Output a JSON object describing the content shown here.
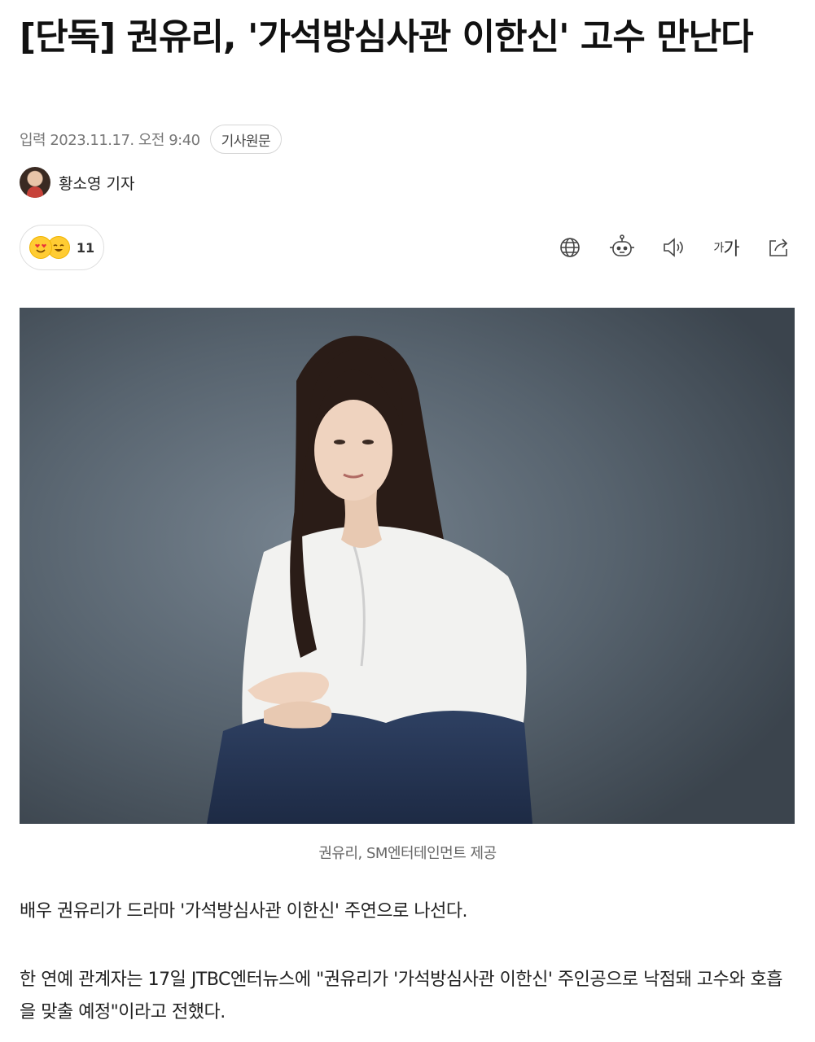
{
  "article": {
    "title": "[단독] 권유리, '가석방심사관 이한신' 고수 만난다",
    "published_label": "입력",
    "published_at": "2023.11.17. 오전 9:40",
    "original_article_button": "기사원문",
    "reporter": "황소영 기자",
    "reaction_count": "11",
    "toolbar": {
      "icons": [
        "globe-icon",
        "robot-icon",
        "speaker-icon",
        "font-size-icon",
        "share-icon"
      ],
      "font_size_small": "가",
      "font_size_large": "가"
    },
    "photo_caption": "권유리, SM엔터테인먼트 제공",
    "paragraphs": [
      "배우 권유리가 드라마 '가석방심사관 이한신' 주연으로 나선다.",
      "한 연예 관계자는 17일 JTBC엔터뉴스에 \"권유리가 '가석방심사관 이한신' 주인공으로 낙점돼 고수와 호흡을 맞출 예정\"이라고 전했다."
    ]
  }
}
